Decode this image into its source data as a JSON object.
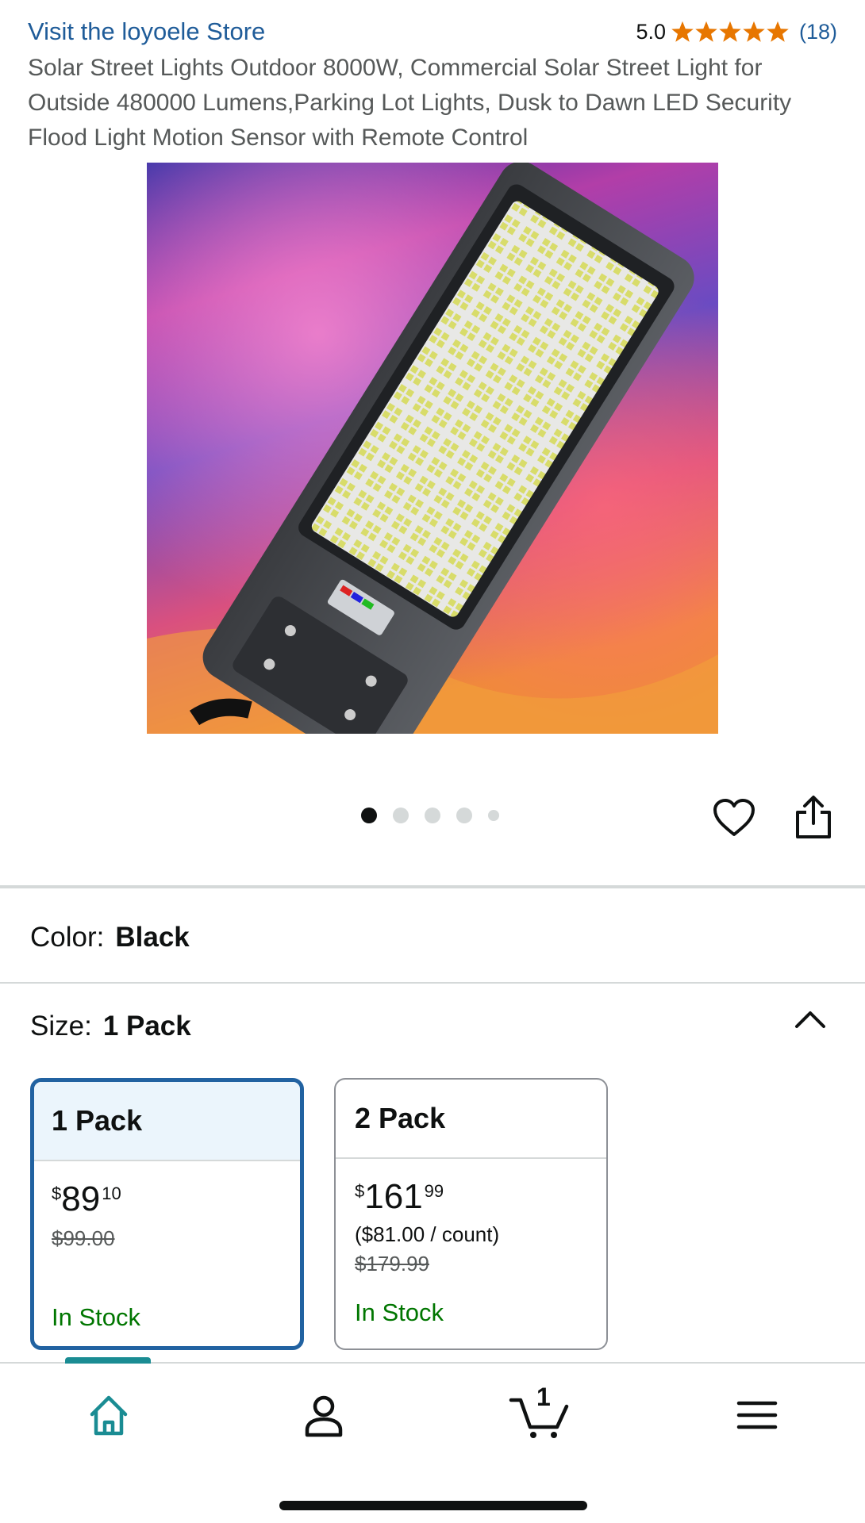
{
  "store": {
    "link_text": "Visit the loyoele Store"
  },
  "rating": {
    "value": "5.0",
    "stars": 5,
    "count": "(18)",
    "star_color": "#e77600"
  },
  "product": {
    "title": "Solar Street Lights Outdoor 8000W, Commercial Solar Street Light for Outside 480000 Lumens,Parking Lot Lights, Dusk to Dawn LED Security Flood Light Motion Sensor with Remote Control",
    "image_label": "Solar Street Light"
  },
  "carousel": {
    "total_dots": 5,
    "active_index": 0
  },
  "actions": {
    "favorite_icon": "heart-icon",
    "share_icon": "share-icon"
  },
  "color": {
    "label": "Color:",
    "value": "Black"
  },
  "size": {
    "label": "Size:",
    "value": "1 Pack",
    "options": [
      {
        "name": "1 Pack",
        "currency": "$",
        "whole": "89",
        "fraction": "10",
        "unit_price": "",
        "list_price": "$99.00",
        "availability": "In Stock",
        "selected": true
      },
      {
        "name": "2 Pack",
        "currency": "$",
        "whole": "161",
        "fraction": "99",
        "unit_price": "($81.00 / count)",
        "list_price": "$179.99",
        "availability": "In Stock",
        "selected": false
      }
    ]
  },
  "bottom_nav": {
    "items": [
      "home-icon",
      "account-icon",
      "cart-icon",
      "menu-icon"
    ],
    "active": "home-icon",
    "cart_count": "1",
    "accent_color": "#1a8c93"
  }
}
